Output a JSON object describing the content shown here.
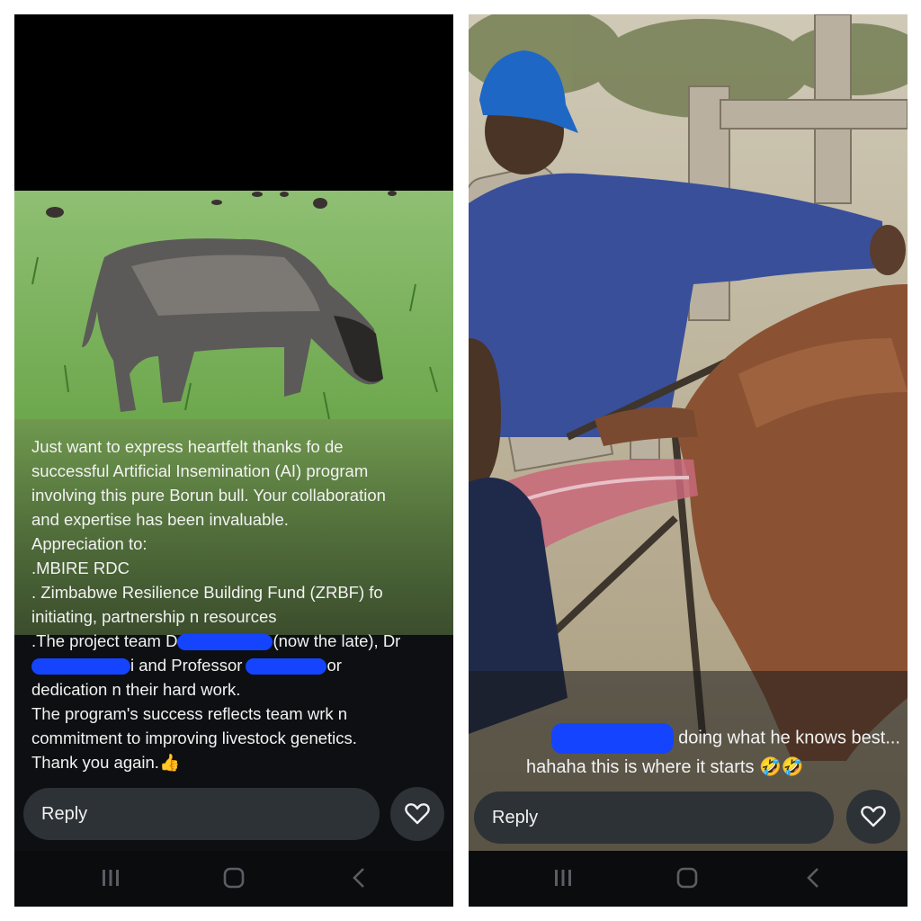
{
  "left_story": {
    "caption_lines": [
      "Just want to express heartfelt thanks fo de",
      "successful Artificial Insemination (AI) program",
      "involving this pure Borun bull. Your collaboration",
      "and expertise has been invaluable.",
      "Appreciation to:",
      ".MBIRE RDC",
      ". Zimbabwe Resilience Building Fund (ZRBF) fo",
      "initiating, partnership n resources"
    ],
    "line9_a": ".The project team D",
    "line9_b": "(now the late), Dr",
    "line10_a": "i and Professor",
    "line10_b": "or",
    "line11": "dedication n their hard work.",
    "line12": "The program's success reflects team wrk n",
    "line13": "commitment to improving livestock genetics.",
    "line14": "Thank you again.",
    "emoji": "👍",
    "reply_label": "Reply"
  },
  "right_story": {
    "caption_line1": "doing what he knows best...",
    "caption_line2": "hahaha this is where it starts",
    "emoji": "🤣🤣",
    "reply_label": "Reply"
  },
  "icons": {
    "heart": "heart-icon",
    "recents": "recent-apps-icon",
    "home": "home-icon",
    "back": "back-icon"
  },
  "colors": {
    "redaction": "#1544ff",
    "panel_bg": "#0d0f12",
    "reply_bg": "#2d3237"
  }
}
